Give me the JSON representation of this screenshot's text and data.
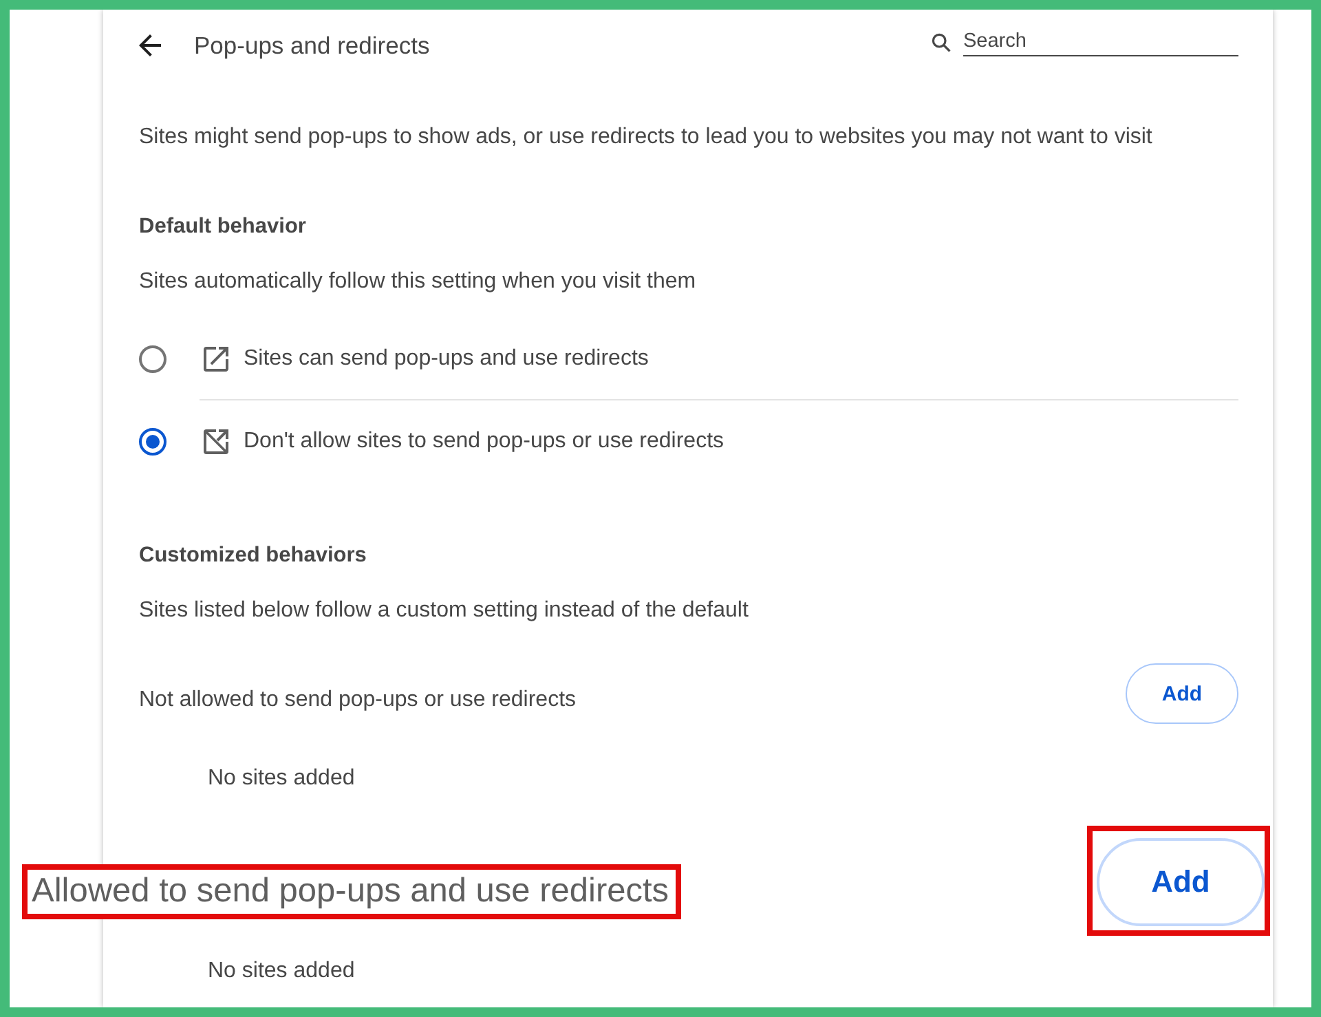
{
  "header": {
    "title": "Pop-ups and redirects",
    "search": {
      "placeholder": "Search"
    }
  },
  "description": "Sites might send pop-ups to show ads, or use redirects to lead you to websites you may not want to visit",
  "default_behavior": {
    "heading": "Default behavior",
    "subtitle": "Sites automatically follow this setting when you visit them",
    "options": [
      {
        "kind": "allow",
        "label": "Sites can send pop-ups and use redirects",
        "selected": false
      },
      {
        "kind": "block",
        "label": "Don't allow sites to send pop-ups or use redirects",
        "selected": true
      }
    ]
  },
  "customized_behaviors": {
    "heading": "Customized behaviors",
    "subtitle": "Sites listed below follow a custom setting instead of the default",
    "lists": [
      {
        "title": "Not allowed to send pop-ups or use redirects",
        "add_button": "Add",
        "empty_text": "No sites added",
        "highlighted": false
      },
      {
        "title": "Allowed to send pop-ups and use redirects",
        "add_button": "Add",
        "empty_text": "No sites added",
        "highlighted": true
      }
    ]
  }
}
